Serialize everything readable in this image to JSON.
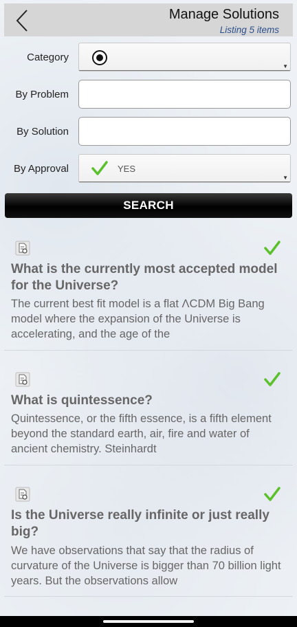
{
  "header": {
    "title": "Manage Solutions",
    "subtitle": "Listing 5 items"
  },
  "form": {
    "category_label": "Category",
    "problem_label": "By Problem",
    "problem_value": "",
    "solution_label": "By Solution",
    "solution_value": "",
    "approval_label": "By Approval",
    "approval_value": "YES"
  },
  "search_label": "SEARCH",
  "items": [
    {
      "title": "What is the currently most accepted model for the Universe?",
      "description": "The current best fit model is a flat ΛCDM Big Bang model where the expansion of the Universe is accelerating, and the age of the"
    },
    {
      "title": "What is quintessence?",
      "description": "Quintessence, or the fifth essence, is a fifth element beyond the standard earth, air, fire and water of ancient chemistry. Steinhardt"
    },
    {
      "title": "Is the Universe really infinite or just really big?",
      "description": "We have observations that say that the radius of curvature of the Universe is bigger than 70 billion light years. But the observations allow"
    }
  ],
  "colors": {
    "check": "#5cc02c",
    "subtitle": "#2b4f8c",
    "header_bg": "#d6d6d6"
  }
}
